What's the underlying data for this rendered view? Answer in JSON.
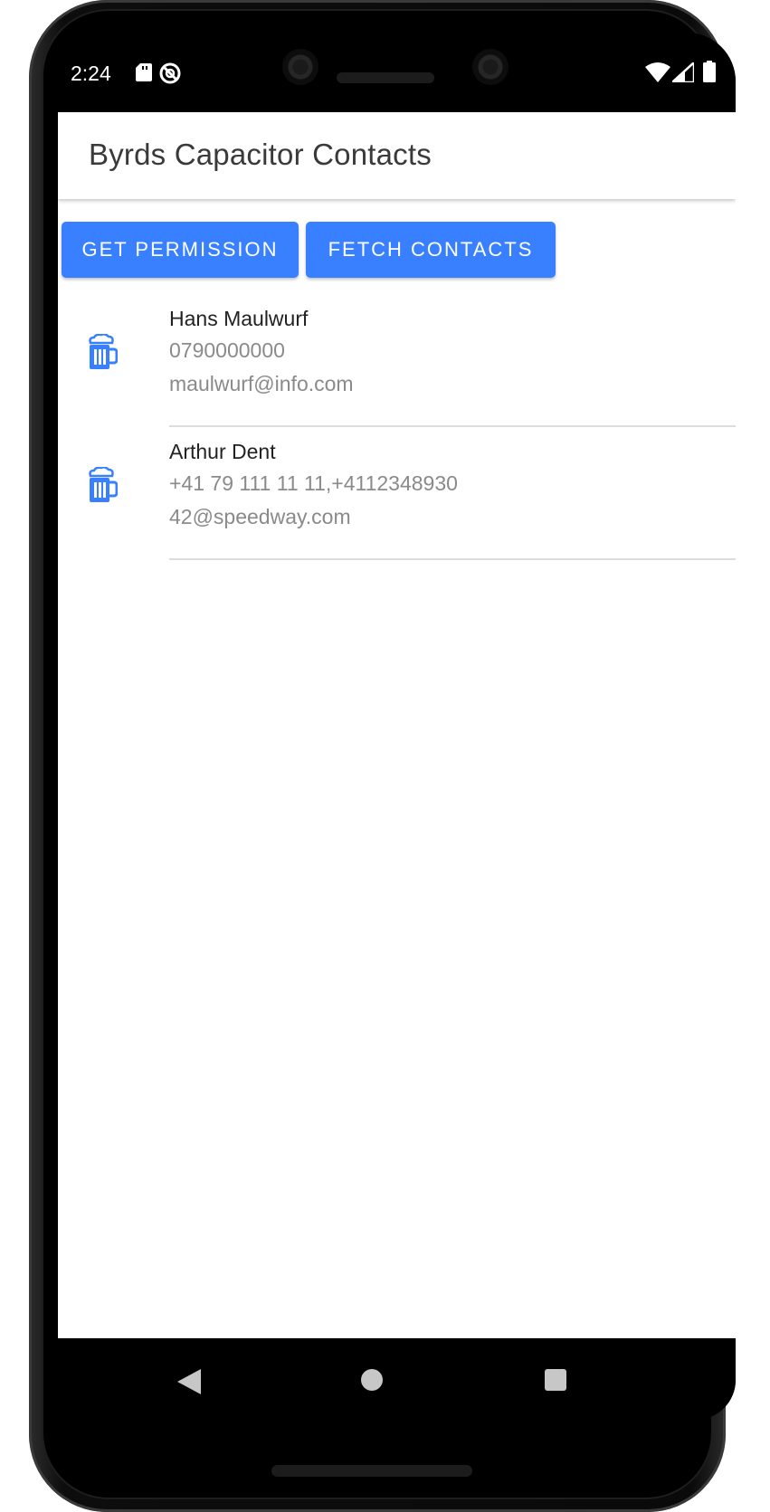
{
  "status_bar": {
    "time": "2:24",
    "icons": [
      "sd-card-icon",
      "no-disturb-icon",
      "wifi-icon",
      "cellular-signal-icon",
      "battery-icon"
    ]
  },
  "app": {
    "title": "Byrds Capacitor Contacts",
    "accent_color": "#3880ff"
  },
  "actions": {
    "get_permission_label": "GET PERMISSION",
    "fetch_contacts_label": "FETCH CONTACTS"
  },
  "contacts": [
    {
      "icon": "beer-mug-icon",
      "name": "Hans Maulwurf",
      "phone": "0790000000",
      "email": "maulwurf@info.com"
    },
    {
      "icon": "beer-mug-icon",
      "name": "Arthur Dent",
      "phone": "+41 79 111 11 11,+4112348930",
      "email": "42@speedway.com"
    }
  ],
  "nav_bar": {
    "icons": [
      "back-icon",
      "home-icon",
      "recents-icon"
    ]
  }
}
